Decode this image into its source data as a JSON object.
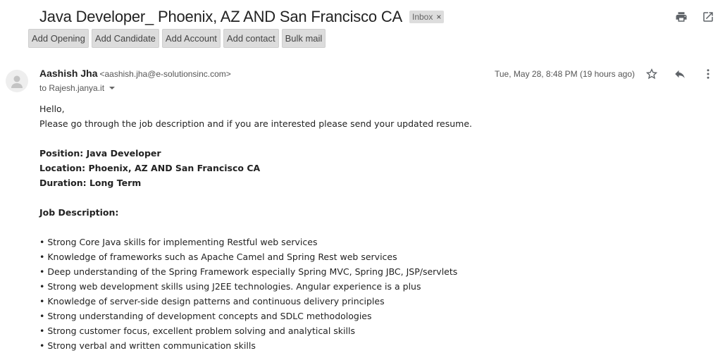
{
  "subject": "Java Developer_ Phoenix, AZ AND San Francisco CA",
  "label": {
    "text": "Inbox",
    "close": "×"
  },
  "toolbar_icons": [
    "print-icon",
    "open-in-new-window-icon"
  ],
  "actions": [
    "Add Opening",
    "Add Candidate",
    "Add Account",
    "Add contact",
    "Bulk mail"
  ],
  "sender": {
    "name": "Aashish Jha",
    "email": "<aashish.jha@e-solutionsinc.com>"
  },
  "recipient": "to Rajesh.janya.it",
  "timestamp": "Tue, May 28, 8:48 PM (19 hours ago)",
  "message_icons": [
    "star-icon",
    "reply-icon",
    "more-vert-icon"
  ],
  "body": {
    "greeting": "Hello,",
    "intro": "Please go through the job description and if you are interested please send your updated resume.",
    "position": "Position: Java Developer",
    "location": "Location: Phoenix, AZ AND San Francisco CA",
    "duration": "Duration: Long Term",
    "job_description_heading": "Job Description:",
    "bullets": [
      "• Strong Core Java skills for implementing Restful web services",
      "• Knowledge of frameworks such as Apache Camel and Spring Rest web services",
      "• Deep understanding of the Spring Framework especially Spring MVC, Spring JBC, JSP/servlets",
      "• Strong web development skills using J2EE technologies. Angular experience is a plus",
      "• Knowledge of server-side design patterns and continuous delivery principles",
      "• Strong understanding of development concepts and SDLC methodologies",
      "• Strong customer focus, excellent problem solving and analytical skills",
      "• Strong verbal and written communication skills"
    ]
  }
}
